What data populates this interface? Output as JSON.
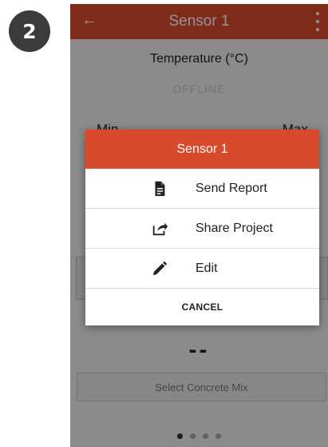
{
  "step_badge": "2",
  "appbar": {
    "title": "Sensor 1",
    "back_icon": "arrow-left-icon",
    "menu_icon": "more-vertical-icon"
  },
  "content": {
    "temperature_label": "Temperature (°C)",
    "status": "OFFLINE",
    "min_label": "Min",
    "max_label": "Max",
    "reading": "--",
    "select_mix_label": "Select Concrete Mix"
  },
  "pager": {
    "pages": 4,
    "active_index": 0
  },
  "dialog": {
    "title": "Sensor 1",
    "items": [
      {
        "label": "Send Report",
        "icon": "document-icon"
      },
      {
        "label": "Share Project",
        "icon": "share-icon"
      },
      {
        "label": "Edit",
        "icon": "pencil-icon"
      }
    ],
    "cancel_label": "CANCEL"
  },
  "colors": {
    "accent": "#d94a2c",
    "badge": "#3b3b3b"
  }
}
